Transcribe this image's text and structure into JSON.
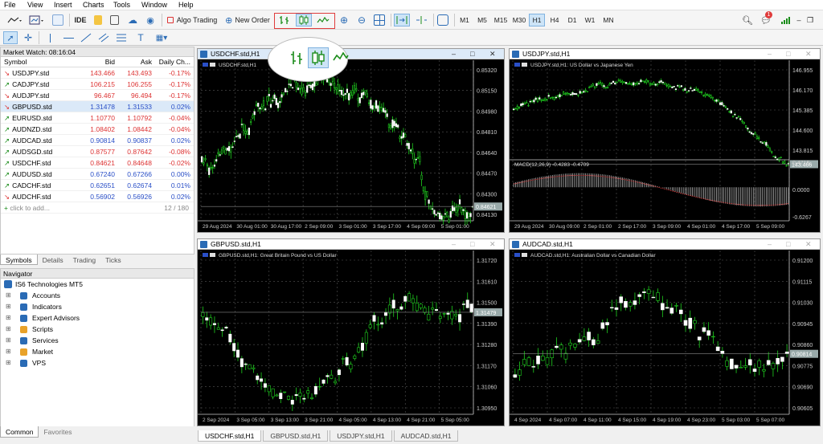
{
  "menu": [
    "File",
    "View",
    "Insert",
    "Charts",
    "Tools",
    "Window",
    "Help"
  ],
  "toolbar": {
    "ide": "IDE",
    "algo": "Algo Trading",
    "neworder": "New Order",
    "timeframes": [
      "M1",
      "M5",
      "M15",
      "M30",
      "H1",
      "H4",
      "D1",
      "W1",
      "MN"
    ],
    "selected_tf": "H1",
    "notif_count": "1"
  },
  "market_watch": {
    "title": "Market Watch: 08:16:04",
    "headers": [
      "Symbol",
      "Bid",
      "Ask",
      "Daily Ch..."
    ],
    "rows": [
      {
        "symbol": "USDJPY.std",
        "bid": "143.466",
        "ask": "143.493",
        "chg": "-0.17%",
        "dir": "down"
      },
      {
        "symbol": "CADJPY.std",
        "bid": "106.215",
        "ask": "106.255",
        "chg": "-0.17%",
        "dir": "up"
      },
      {
        "symbol": "AUDJPY.std",
        "bid": "96.467",
        "ask": "96.494",
        "chg": "-0.17%",
        "dir": "down"
      },
      {
        "symbol": "GBPUSD.std",
        "bid": "1.31478",
        "ask": "1.31533",
        "chg": "0.02%",
        "dir": "down"
      },
      {
        "symbol": "EURUSD.std",
        "bid": "1.10770",
        "ask": "1.10792",
        "chg": "-0.04%",
        "dir": "up"
      },
      {
        "symbol": "AUDNZD.std",
        "bid": "1.08402",
        "ask": "1.08442",
        "chg": "-0.04%",
        "dir": "up"
      },
      {
        "symbol": "AUDCAD.std",
        "bid": "0.90814",
        "ask": "0.90837",
        "chg": "0.02%",
        "dir": "up"
      },
      {
        "symbol": "AUDSGD.std",
        "bid": "0.87577",
        "ask": "0.87642",
        "chg": "-0.08%",
        "dir": "up"
      },
      {
        "symbol": "USDCHF.std",
        "bid": "0.84621",
        "ask": "0.84648",
        "chg": "-0.02%",
        "dir": "up"
      },
      {
        "symbol": "AUDUSD.std",
        "bid": "0.67240",
        "ask": "0.67266",
        "chg": "0.00%",
        "dir": "up"
      },
      {
        "symbol": "CADCHF.std",
        "bid": "0.62651",
        "ask": "0.62674",
        "chg": "0.01%",
        "dir": "up"
      },
      {
        "symbol": "AUDCHF.std",
        "bid": "0.56902",
        "ask": "0.56926",
        "chg": "0.02%",
        "dir": "down"
      }
    ],
    "add": "click to add...",
    "count": "12 / 180",
    "tabs": [
      "Symbols",
      "Details",
      "Trading",
      "Ticks"
    ]
  },
  "navigator": {
    "title": "Navigator",
    "root": "IS6 Technologies MT5",
    "items": [
      "Accounts",
      "Indicators",
      "Expert Advisors",
      "Scripts",
      "Services",
      "Market",
      "VPS"
    ],
    "tabs": [
      "Common",
      "Favorites"
    ]
  },
  "charts": [
    {
      "tab": "USDCHF.std,H1",
      "label": "USDCHF.std,H1",
      "prices": [
        "0.85320",
        "0.85150",
        "0.84980",
        "0.84810",
        "0.84640",
        "0.84470",
        "0.84300",
        "0.84130"
      ],
      "current": "0.84621",
      "dates": [
        "29 Aug 2024",
        "30 Aug 01:00",
        "30 Aug 17:00",
        "2 Sep 09:00",
        "3 Sep 01:00",
        "3 Sep 17:00",
        "4 Sep 09:00",
        "5 Sep 01:00"
      ]
    },
    {
      "tab": "USDJPY.std,H1",
      "label": "USDJPY.std,H1: US Dollar vs Japanese Yen",
      "prices": [
        "146.955",
        "146.170",
        "145.385",
        "144.600",
        "143.815"
      ],
      "current": "143.466",
      "macd": "MACD(12,26,9) -0.4283 -0.4709",
      "macd_scale": [
        "0.4715",
        "0.0000",
        "-0.6267"
      ],
      "dates": [
        "29 Aug 2024",
        "30 Aug 09:00",
        "2 Sep 01:00",
        "2 Sep 17:00",
        "3 Sep 09:00",
        "4 Sep 01:00",
        "4 Sep 17:00",
        "5 Sep 09:00"
      ]
    },
    {
      "tab": "GBPUSD.std,H1",
      "label": "GBPUSD.std,H1: Great Britain Pound vs US Dollar",
      "prices": [
        "1.31720",
        "1.31610",
        "1.31500",
        "1.31390",
        "1.31280",
        "1.31170",
        "1.31060",
        "1.30950"
      ],
      "current": "1.31479",
      "dates": [
        "2 Sep 2024",
        "3 Sep 05:00",
        "3 Sep 13:00",
        "3 Sep 21:00",
        "4 Sep 05:00",
        "4 Sep 13:00",
        "4 Sep 21:00",
        "5 Sep 05:00"
      ]
    },
    {
      "tab": "AUDCAD.std,H1",
      "label": "AUDCAD.std,H1: Australian Dollar vs Canadian Dollar",
      "prices": [
        "0.91200",
        "0.91115",
        "0.91030",
        "0.90945",
        "0.90860",
        "0.90775",
        "0.90690",
        "0.90605"
      ],
      "current": "0.90814",
      "dates": [
        "4 Sep 2024",
        "4 Sep 07:00",
        "4 Sep 11:00",
        "4 Sep 15:00",
        "4 Sep 19:00",
        "4 Sep 23:00",
        "5 Sep 03:00",
        "5 Sep 07:00"
      ]
    }
  ]
}
